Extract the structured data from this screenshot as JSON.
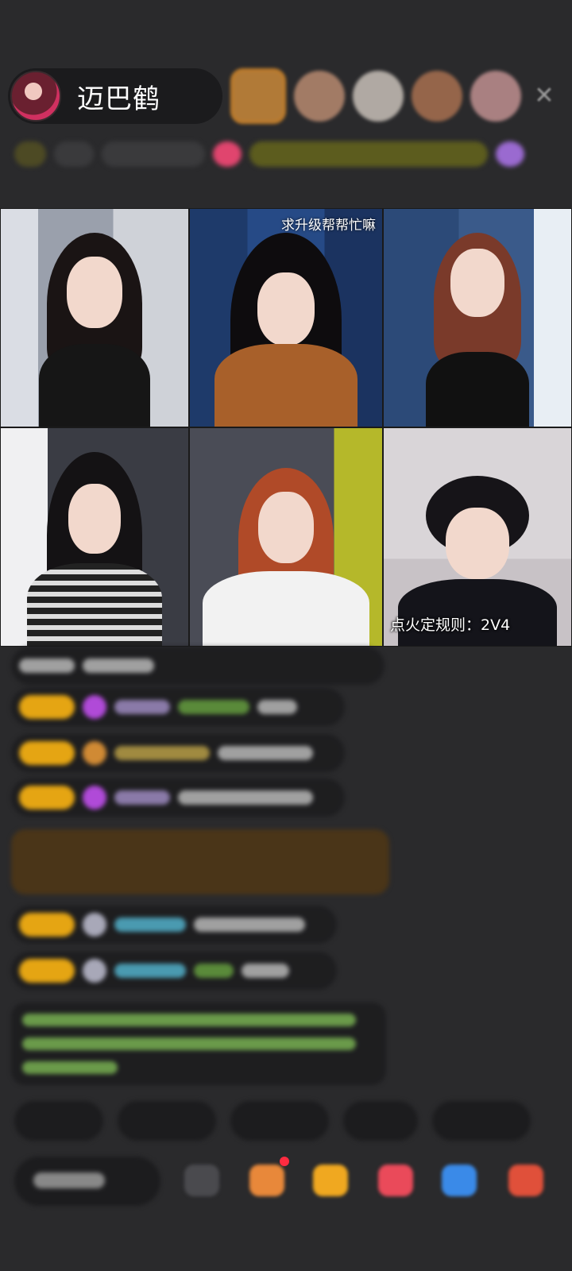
{
  "host": {
    "name": "迈巴鹤"
  },
  "viewers": [
    {
      "color": "#c9883a"
    },
    {
      "color": "#b88a70"
    },
    {
      "color": "#c8c0b8"
    },
    {
      "color": "#a87050"
    },
    {
      "color": "#c09090"
    }
  ],
  "video_grid": {
    "top_center_caption": "求升级帮帮忙嘛",
    "rule_text": "点火定规则：2V4"
  },
  "colors": {
    "background": "#2a2a2c",
    "level_badge": "#e5a513",
    "highlight_message": "#4a3518",
    "notice_text": "#6a9a4a",
    "notification_dot": "#ff2b40"
  },
  "icons": [
    "close-icon",
    "gift-box-icon",
    "gift-icon",
    "wish-icon",
    "share-icon",
    "shop-icon",
    "more-icon"
  ]
}
